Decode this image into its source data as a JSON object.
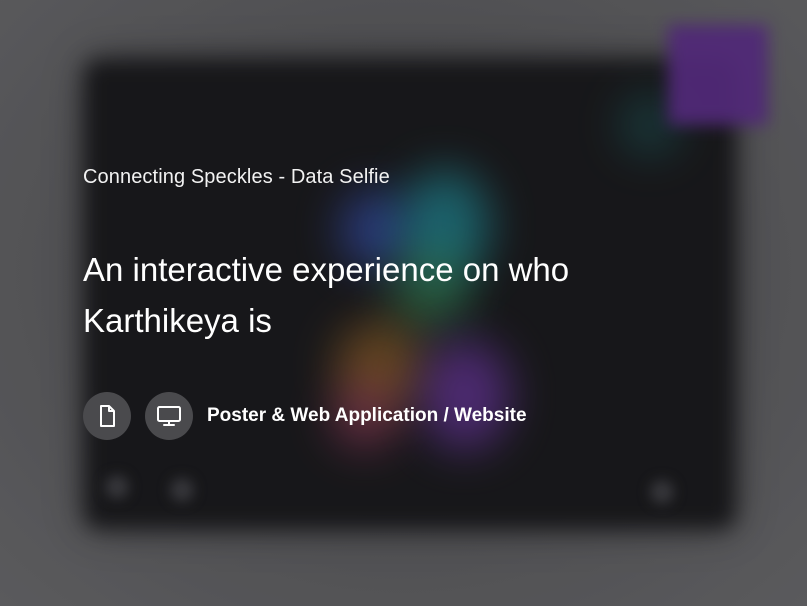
{
  "project": {
    "title": "Connecting Speckles - Data Selfie",
    "headline": "An interactive experience on who Karthikeya is",
    "category_icons": [
      "document-icon",
      "monitor-icon"
    ],
    "category_label": "Poster & Web Application / Website"
  },
  "colors": {
    "background": "#5f5f61",
    "icon_circle": "#4a4a4d",
    "text": "#ffffff",
    "accent_tile": "#5a2a88"
  }
}
